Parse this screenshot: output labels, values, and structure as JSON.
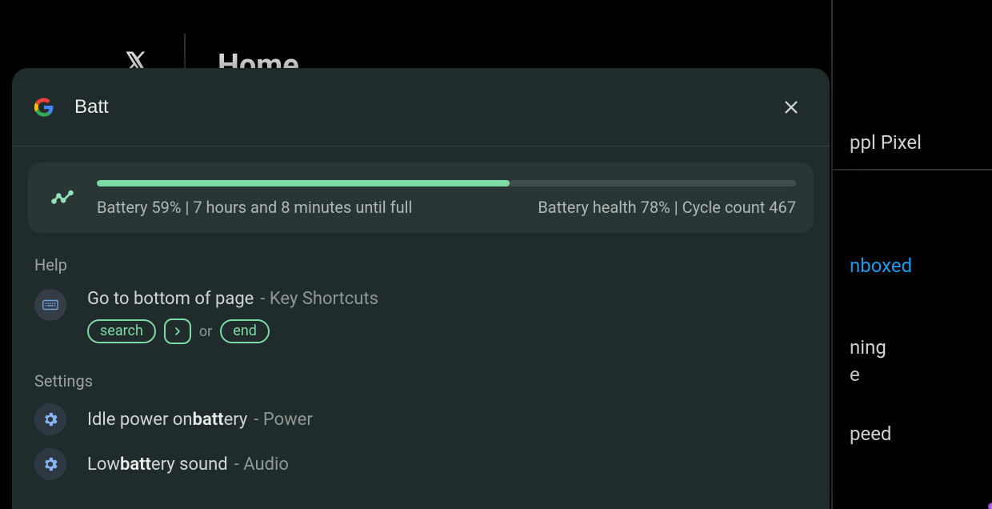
{
  "background": {
    "page_title": "Home",
    "right_texts": {
      "t1": "ppl Pixel",
      "link": "nboxed",
      "t2a": "ning",
      "t2b": "e",
      "t3": "peed"
    }
  },
  "overlay": {
    "search_value": "Batt",
    "battery": {
      "percent": 59,
      "left_text": "Battery 59% | 7 hours and 8 minutes until full",
      "right_text": "Battery health 78% | Cycle count 467"
    },
    "sections": {
      "help_label": "Help",
      "settings_label": "Settings"
    },
    "help_item": {
      "title": "Go to bottom of page",
      "suffix": "- Key Shortcuts",
      "chip1": "search",
      "or": "or",
      "chip2": "end"
    },
    "settings_items": [
      {
        "pre": "Idle power on ",
        "hl": "batt",
        "post": "ery",
        "suffix": "- Power"
      },
      {
        "pre": "Low ",
        "hl": "batt",
        "post": "ery sound",
        "suffix": "- Audio"
      }
    ]
  }
}
